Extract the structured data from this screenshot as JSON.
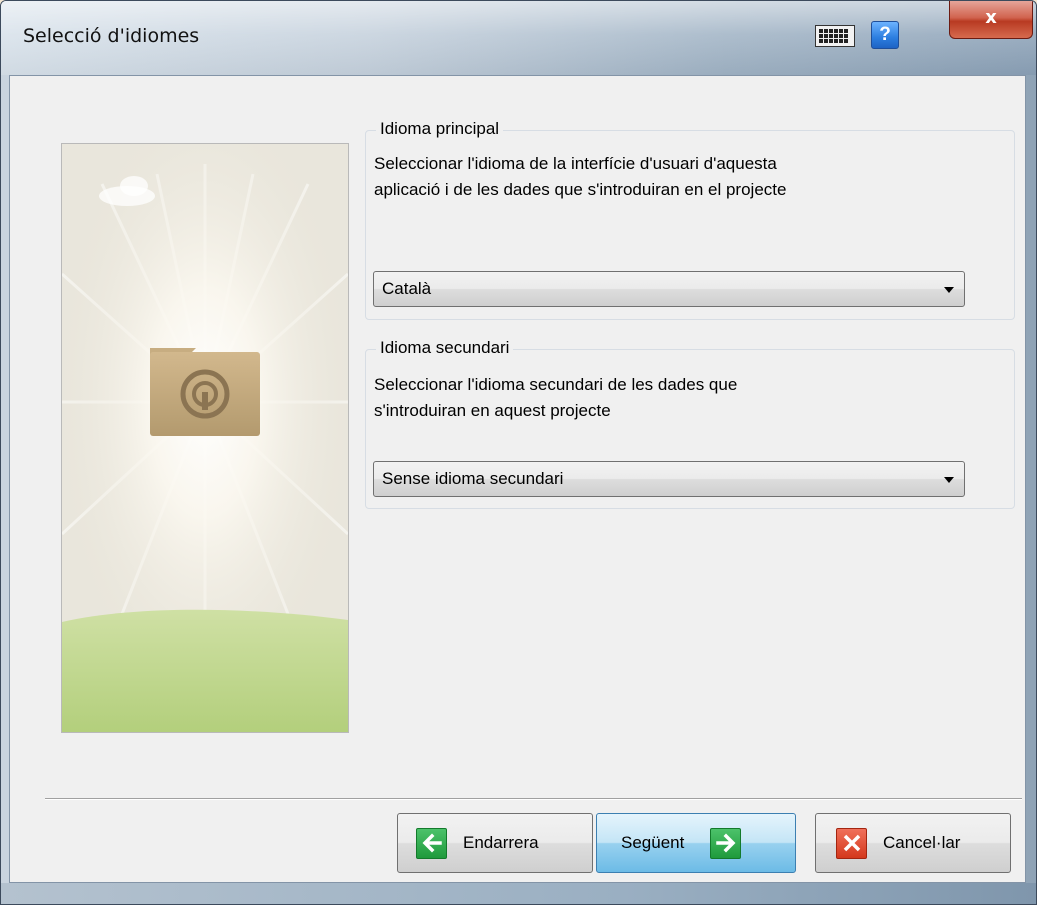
{
  "window": {
    "title": "Selecció d'idiomes",
    "close_label": "x",
    "help_label": "?"
  },
  "icons": {
    "keyboard": "keyboard-icon",
    "help": "help-icon",
    "back": "arrow-left-icon",
    "next": "arrow-right-icon",
    "cancel": "x-cross-icon"
  },
  "primary_language": {
    "group_title": "Idioma principal",
    "description_line1": "Seleccionar l'idioma de la interfície d'usuari d'aquesta",
    "description_line2": "aplicació i de les dades que s'introduiran en el projecte",
    "selected": "Català"
  },
  "secondary_language": {
    "group_title": "Idioma secundari",
    "description_line1": "Seleccionar l'idioma secundari de les dades que",
    "description_line2": "s'introduiran en aquest projecte",
    "selected": "Sense idioma secundari"
  },
  "buttons": {
    "back": "Endarrera",
    "next": "Següent",
    "cancel": "Cancel·lar"
  },
  "colors": {
    "accent_green": "#1f9a3c",
    "cancel_red": "#d4381c",
    "primary_button": "#98d1ef"
  }
}
